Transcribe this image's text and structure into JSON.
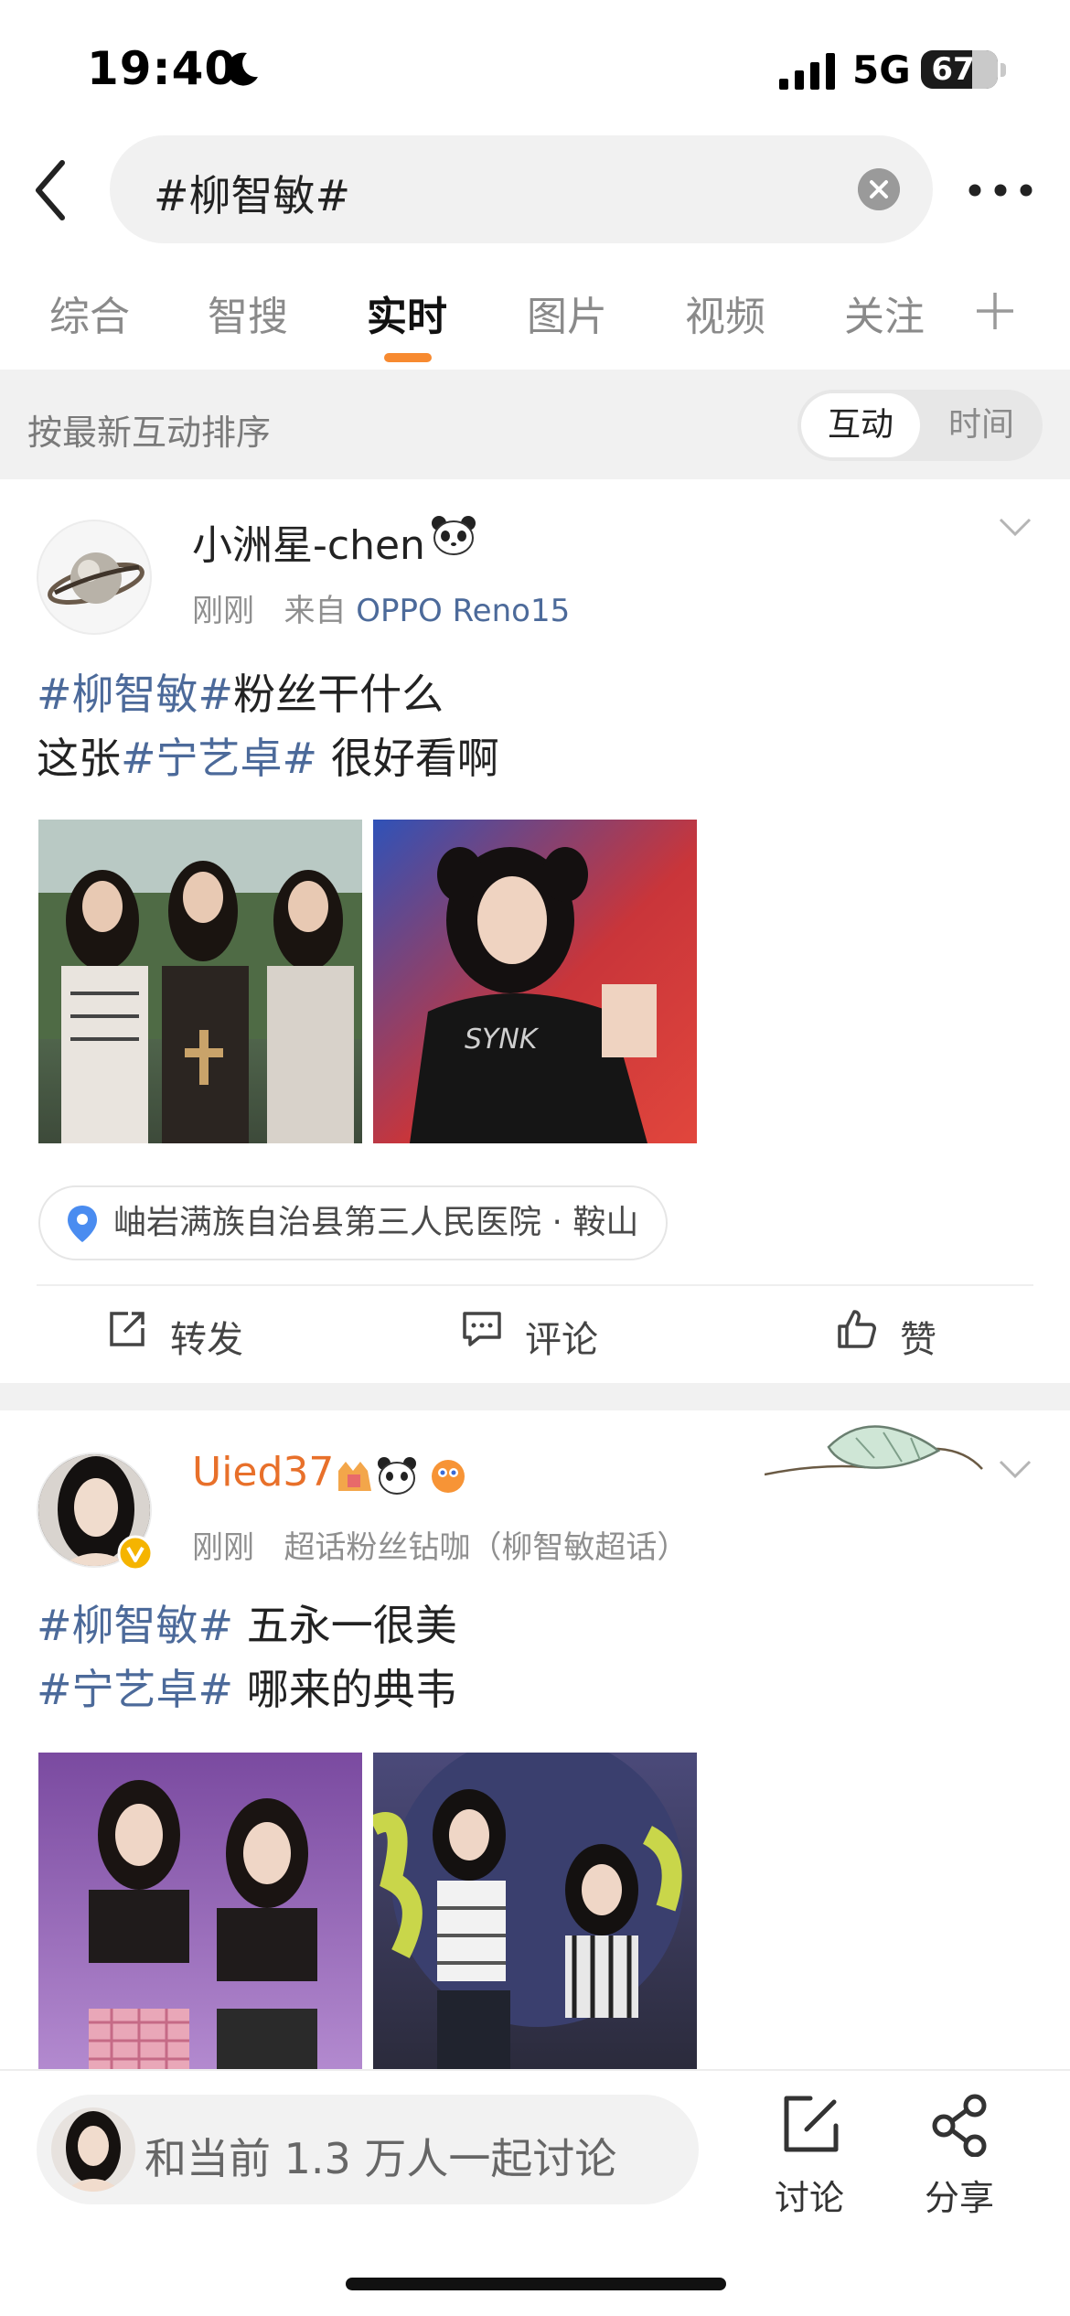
{
  "status_bar": {
    "time": "19:40",
    "network": "5G",
    "battery": "67"
  },
  "search": {
    "query": "#柳智敏#"
  },
  "tabs": [
    {
      "label": "综合"
    },
    {
      "label": "智搜"
    },
    {
      "label": "实时",
      "active": true
    },
    {
      "label": "图片"
    },
    {
      "label": "视频"
    },
    {
      "label": "关注"
    }
  ],
  "sort": {
    "label": "按最新互动排序",
    "options": [
      "互动",
      "时间"
    ],
    "selected": "互动"
  },
  "posts": [
    {
      "username": "小洲星-chen",
      "time": "刚刚",
      "source_prefix": "来自",
      "source": "OPPO Reno15",
      "line1_tag": "#柳智敏#",
      "line1_text": "粉丝干什么",
      "line2_prefix": "这张",
      "line2_tag": "#宁艺卓#",
      "line2_text": " 很好看啊",
      "location": "岫岩满族自治县第三人民医院 · 鞍山",
      "actions": {
        "repost": "转发",
        "comment": "评论",
        "like": "赞"
      }
    },
    {
      "username": "Uied37",
      "time": "刚刚",
      "source": "超话粉丝钻咖（柳智敏超话）",
      "line1_tag": "#柳智敏#",
      "line1_text": "  五永一很美",
      "line2_tag": "#宁艺卓#",
      "line2_text": " 哪来的典韦"
    }
  ],
  "bottom": {
    "discuss_text": "和当前 1.3 万人一起讨论",
    "discuss_button": "讨论",
    "share_button": "分享"
  },
  "colors": {
    "accent": "#f78a30",
    "link": "#4c6a9a",
    "username_vip": "#e8702a"
  }
}
